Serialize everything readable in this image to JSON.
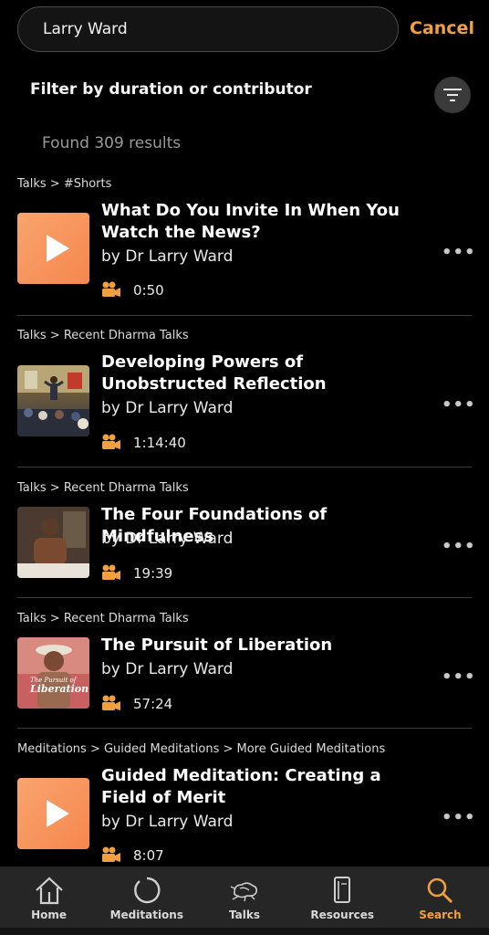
{
  "search": {
    "value": "Larry Ward",
    "cancel_label": "Cancel"
  },
  "filter": {
    "label": "Filter by duration or contributor",
    "icon": "filter-icon"
  },
  "results": {
    "count_text": "Found 309 results",
    "items": [
      {
        "breadcrumb": "Talks > #Shorts",
        "title": "What Do You Invite In When You Watch the News?",
        "author": "by Dr Larry Ward",
        "duration": "0:50",
        "thumb": "play-thumbnail"
      },
      {
        "breadcrumb": "Talks > Recent Dharma Talks",
        "title": "Developing Powers of Unobstructed Reflection",
        "author": "by Dr Larry Ward",
        "duration": "1:14:40",
        "thumb": "photo-speaker-hall"
      },
      {
        "breadcrumb": "Talks > Recent Dharma Talks",
        "title": "The Four Foundations of Mindfulness",
        "author": "by Dr Larry Ward",
        "duration": "19:39",
        "thumb": "photo-speaker-seated"
      },
      {
        "breadcrumb": "Talks > Recent Dharma Talks",
        "title": "The Pursuit of Liberation",
        "author": "by Dr Larry Ward",
        "duration": "57:24",
        "thumb": "book-cover",
        "thumb_text": [
          "The Pursuit of",
          "Liberation"
        ]
      },
      {
        "breadcrumb": "Meditations > Guided Meditations > More Guided Meditations",
        "title": "Guided Meditation: Creating a Field of Merit",
        "author": "by Dr Larry Ward",
        "duration": "8:07",
        "thumb": "play-thumbnail"
      }
    ]
  },
  "nav": {
    "items": [
      {
        "label": "Home",
        "icon": "home-icon",
        "active": false
      },
      {
        "label": "Meditations",
        "icon": "circle-icon",
        "active": false
      },
      {
        "label": "Talks",
        "icon": "talks-icon",
        "active": false
      },
      {
        "label": "Resources",
        "icon": "book-icon",
        "active": false
      },
      {
        "label": "Search",
        "icon": "search-icon",
        "active": true
      }
    ]
  },
  "colors": {
    "accent": "#f0a040",
    "background": "#000000",
    "nav_bg": "#262626"
  }
}
